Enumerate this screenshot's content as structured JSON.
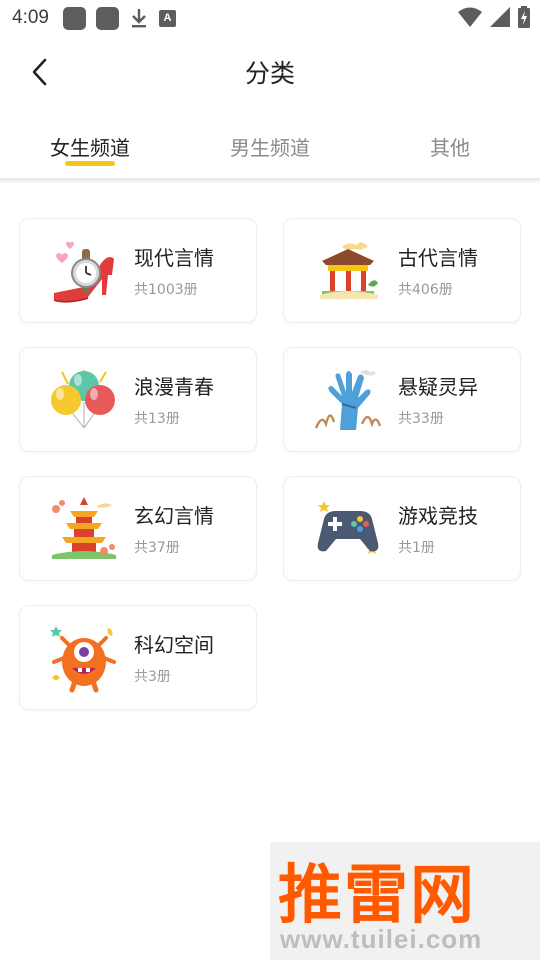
{
  "status_bar": {
    "time": "4:09",
    "icons": [
      "notification-square-icon",
      "notification-square-icon",
      "download-icon",
      "text-a-icon",
      "wifi-icon",
      "signal-icon",
      "battery-charging-icon"
    ]
  },
  "header": {
    "title": "分类",
    "back_icon": "chevron-left-icon"
  },
  "tabs": [
    {
      "label": "女生频道",
      "active": true
    },
    {
      "label": "男生频道",
      "active": false
    },
    {
      "label": "其他",
      "active": false
    }
  ],
  "accent_color": "#f5c518",
  "categories": [
    {
      "name": "现代言情",
      "count": "共1003册",
      "icon": "high-heel-watch-icon"
    },
    {
      "name": "古代言情",
      "count": "共406册",
      "icon": "pavilion-icon"
    },
    {
      "name": "浪漫青春",
      "count": "共13册",
      "icon": "balloons-icon"
    },
    {
      "name": "悬疑灵异",
      "count": "共33册",
      "icon": "zombie-hand-icon"
    },
    {
      "name": "玄幻言情",
      "count": "共37册",
      "icon": "pagoda-icon"
    },
    {
      "name": "游戏竞技",
      "count": "共1册",
      "icon": "gamepad-icon"
    },
    {
      "name": "科幻空间",
      "count": "共3册",
      "icon": "alien-monster-icon"
    }
  ],
  "watermark": {
    "title": "推雷网",
    "url": "www.tuilei.com"
  }
}
